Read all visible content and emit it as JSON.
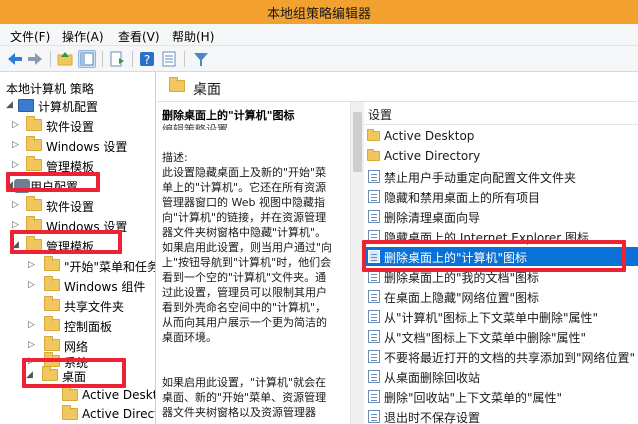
{
  "window": {
    "title": "本地组策略编辑器"
  },
  "menu": [
    {
      "label": "文件(F)"
    },
    {
      "label": "操作(A)"
    },
    {
      "label": "查看(V)"
    },
    {
      "label": "帮助(H)"
    }
  ],
  "tree": [
    {
      "label": "本地计算机 策略",
      "level": 0,
      "icon": "computer-icon",
      "arrow": ""
    },
    {
      "label": "计算机配置",
      "level": 1,
      "icon": "gear-icon",
      "arrow": "◢"
    },
    {
      "label": "软件设置",
      "level": 2,
      "icon": "folder-icon",
      "arrow": "▷"
    },
    {
      "label": "Windows 设置",
      "level": 2,
      "icon": "folder-icon",
      "arrow": "▷"
    },
    {
      "label": "管理模板",
      "level": 2,
      "icon": "folder-icon",
      "arrow": "▷"
    },
    {
      "label": "用户配置",
      "level": 1,
      "icon": "gear-icon",
      "arrow": "◢"
    },
    {
      "label": "软件设置",
      "level": 2,
      "icon": "folder-icon",
      "arrow": "▷"
    },
    {
      "label": "Windows 设置",
      "level": 2,
      "icon": "folder-icon",
      "arrow": "▷"
    },
    {
      "label": "管理模板",
      "level": 2,
      "icon": "folder-icon",
      "arrow": "◢"
    },
    {
      "label": "\"开始\"菜单和任务",
      "level": 3,
      "icon": "folder-icon",
      "arrow": "▷"
    },
    {
      "label": "Windows 组件",
      "level": 3,
      "icon": "folder-icon",
      "arrow": "▷"
    },
    {
      "label": "共享文件夹",
      "level": 3,
      "icon": "folder-icon",
      "arrow": ""
    },
    {
      "label": "控制面板",
      "level": 3,
      "icon": "folder-icon",
      "arrow": "▷"
    },
    {
      "label": "网络",
      "level": 3,
      "icon": "folder-icon",
      "arrow": "▷"
    },
    {
      "label": "系统",
      "level": 3,
      "icon": "folder-icon",
      "arrow": "▷"
    },
    {
      "label": "桌面",
      "level": 3,
      "icon": "folder-icon",
      "arrow": "◢"
    },
    {
      "label": "Active Deskt",
      "level": 4,
      "icon": "folder-icon",
      "arrow": ""
    },
    {
      "label": "Active Direct",
      "level": 4,
      "icon": "folder-icon",
      "arrow": ""
    }
  ],
  "pane": {
    "header": "桌面"
  },
  "description": {
    "title": "删除桌面上的\"计算机\"图标",
    "clipped_line": "编辑策略设置",
    "label": "描述:",
    "para1": "此设置隐藏桌面上及新的\"开始\"菜\n单上的\"计算机\"。它还在所有资源\n管理器窗口的 Web 视图中隐藏指\n向\"计算机\"的链接，并在资源管理\n器文件夹树窗格中隐藏\"计算机\"。\n如果启用此设置，则当用户通过\"向\n上\"按钮导航到\"计算机\"时，他们会\n看到一个空的\"计算机\"文件夹。通\n过此设置，管理员可以限制其用户\n看到外壳命名空间中的\"计算机\"，\n从而向其用户展示一个更为简洁的\n桌面环境。",
    "para2": "如果启用此设置，\"计算机\"就会在\n桌面、新的\"开始\"菜单、资源管理\n器文件夹树窗格以及资源管理器"
  },
  "settings": {
    "header": "设置",
    "rows": [
      {
        "label": "Active Desktop",
        "icon": "folder-icon"
      },
      {
        "label": "Active Directory",
        "icon": "folder-icon"
      },
      {
        "label": "禁止用户手动重定向配置文件文件夹",
        "icon": "policy-icon"
      },
      {
        "label": "隐藏和禁用桌面上的所有项目",
        "icon": "policy-icon"
      },
      {
        "label": "删除清理桌面向导",
        "icon": "policy-icon"
      },
      {
        "label": "隐藏桌面上的 Internet Explorer 图标",
        "icon": "policy-icon"
      },
      {
        "label": "删除桌面上的\"计算机\"图标",
        "icon": "policy-icon",
        "selected": true
      },
      {
        "label": "删除桌面上的\"我的文档\"图标",
        "icon": "policy-icon"
      },
      {
        "label": "在桌面上隐藏\"网络位置\"图标",
        "icon": "policy-icon"
      },
      {
        "label": "从\"计算机\"图标上下文菜单中删除\"属性\"",
        "icon": "policy-icon"
      },
      {
        "label": "从\"文档\"图标上下文菜单中删除\"属性\"",
        "icon": "policy-icon"
      },
      {
        "label": "不要将最近打开的文档的共享添加到\"网络位置\"",
        "icon": "policy-icon"
      },
      {
        "label": "从桌面删除回收站",
        "icon": "policy-icon"
      },
      {
        "label": "删除\"回收站\"上下文菜单的\"属性\"",
        "icon": "policy-icon"
      },
      {
        "label": "退出时不保存设置",
        "icon": "policy-icon"
      }
    ]
  },
  "colors": {
    "titlebar": "#f2a12f",
    "selection": "#0a72d6",
    "highlight_box": "#ee2233"
  }
}
